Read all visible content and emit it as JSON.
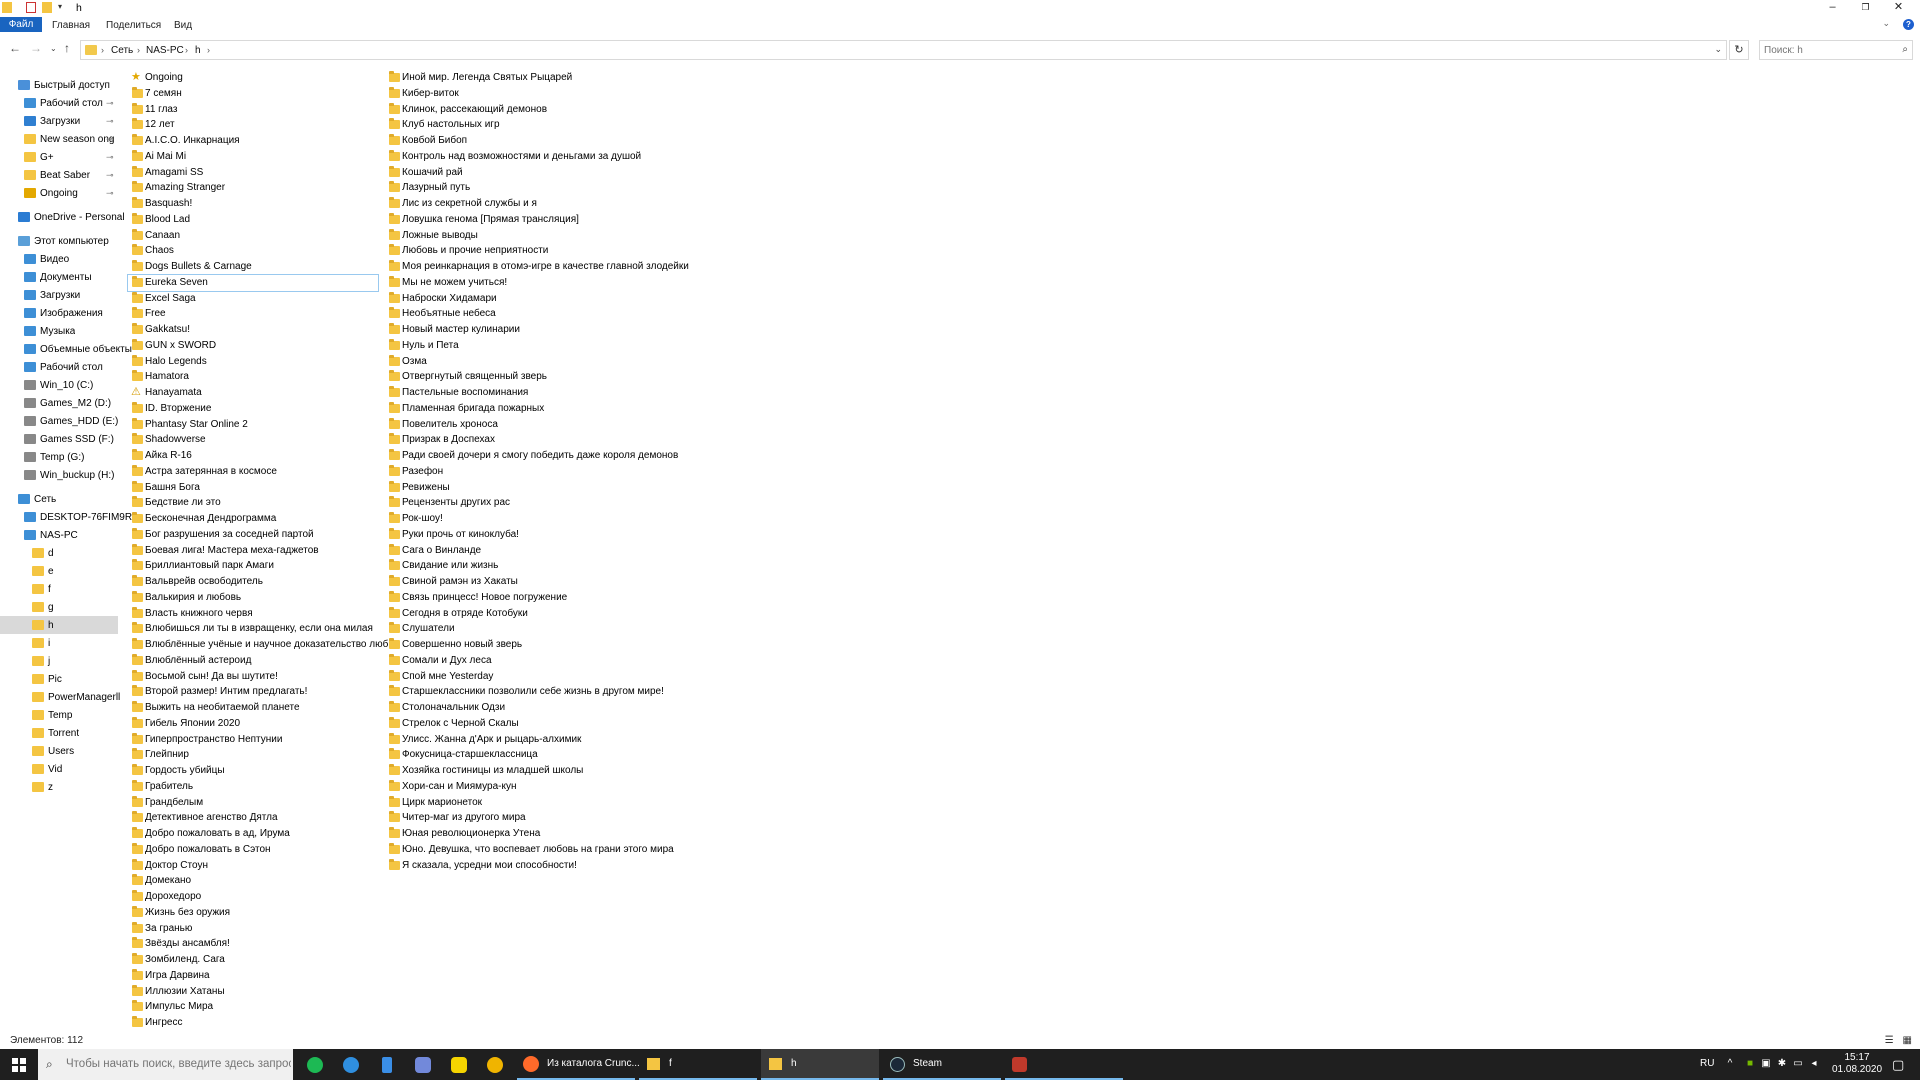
{
  "titlebar": {
    "title": "h",
    "minimize": "–",
    "maximize": "❐",
    "close": "✕"
  },
  "ribbon": {
    "tabs": [
      "Файл",
      "Главная",
      "Поделиться",
      "Вид"
    ]
  },
  "address": {
    "crumbs": [
      "Сеть",
      "NAS-PC",
      "h"
    ],
    "search_placeholder": "Поиск: h"
  },
  "navpane": {
    "quick_access": "Быстрый доступ",
    "quick_items": [
      "Рабочий стол",
      "Загрузки",
      "New season ong",
      "G+",
      "Beat Saber",
      "Ongoing"
    ],
    "onedrive": "OneDrive - Personal",
    "this_pc": "Этот компьютер",
    "pc_items": [
      "Видео",
      "Документы",
      "Загрузки",
      "Изображения",
      "Музыка",
      "Объемные объекты",
      "Рабочий стол",
      "Win_10 (C:)",
      "Games_M2 (D:)",
      "Games_HDD (E:)",
      "Games SSD (F:)",
      "Temp (G:)",
      "Win_buckup (H:)"
    ],
    "network": "Сеть",
    "network_items": [
      "DESKTOP-76FIM9R",
      "NAS-PC"
    ],
    "nas_items": [
      "d",
      "e",
      "f",
      "g",
      "h",
      "i",
      "j",
      "Pic",
      "PowerManagerll",
      "Temp",
      "Torrent",
      "Users",
      "Vid",
      "z"
    ]
  },
  "files": {
    "col1": [
      "Ongoing",
      "7 семян",
      "11 глаз",
      "12 лет",
      "A.I.C.O. Инкарнация",
      "Ai Mai Mi",
      "Amagami SS",
      "Amazing Stranger",
      "Basquash!",
      "Blood Lad",
      "Canaan",
      "Chaos",
      "Dogs Bullets & Carnage",
      "Eureka Seven",
      "Excel Saga",
      "Free",
      "Gakkatsu!",
      "GUN x SWORD",
      "Halo Legends",
      "Hamatora",
      "Hanayamata",
      "ID. Вторжение",
      "Phantasy Star Online 2",
      "Shadowverse",
      "Айка R-16",
      "Астра затерянная в космосе",
      "Башня Бога",
      "Бедствие ли это",
      "Бесконечная Дендрограмма",
      "Бог разрушения за соседней партой",
      "Боевая лига! Мастера меха-гаджетов",
      "Бриллиантовый парк Амаги",
      "Вальврейв освободитель",
      "Валькирия и любовь",
      "Власть книжного червя",
      "Влюбишься ли ты в извращенку, если она милая",
      "Влюблённые учёные и научное доказательство любви",
      "Влюблённый астероид",
      "Восьмой сын! Да вы шутите!",
      "Второй размер! Интим предлагать!",
      "Выжить на необитаемой планете",
      "Гибель Японии 2020",
      "Гиперпространство Нептунии",
      "Глейпнир",
      "Гордость убийцы",
      "Грабитель",
      "Грандбелым",
      "Детективное агенство Дятла",
      "Добро пожаловать в ад, Ирума",
      "Добро пожаловать в Сэтон",
      "Доктор Стоун",
      "Домекано",
      "Дорохедоро",
      "Жизнь без оружия",
      "За гранью",
      "Звёзды ансамбля!",
      "Зомбиленд. Сага",
      "Игра Дарвина",
      "Иллюзии Хатаны",
      "Импульс Мира",
      "Ингресс"
    ],
    "col2": [
      "Иной мир. Легенда Святых Рыцарей",
      "Кибер-виток",
      "Клинок, рассекающий демонов",
      "Клуб настольных игр",
      "Ковбой Бибоп",
      "Контроль над возможностями и деньгами за душой",
      "Кошачий рай",
      "Лазурный путь",
      "Лис из секретной службы и я",
      "Ловушка генома [Прямая трансляция]",
      "Ложные выводы",
      "Любовь и прочие неприятности",
      "Моя реинкарнация в отомэ-игре в качестве главной злодейки",
      "Мы не можем учиться!",
      "Наброски Хидамари",
      "Необъятные небеса",
      "Новый мастер кулинарии",
      "Нуль и Пета",
      "Озма",
      "Отвергнутый священный зверь",
      "Пастельные воспоминания",
      "Пламенная бригада пожарных",
      "Повелитель хроноса",
      "Призрак в Доспехах",
      "Ради своей дочери я смогу победить даже короля демонов",
      "Разефон",
      "Ревижены",
      "Рецензенты других рас",
      "Рок-шоу!",
      "Руки прочь от киноклуба!",
      "Сага о Винланде",
      "Свидание или жизнь",
      "Свиной рамэн из Хакаты",
      "Связь принцесс! Новое погружение",
      "Сегодня в отряде Котобуки",
      "Слушатели",
      "Совершенно новый зверь",
      "Сомали и Дух леса",
      "Спой мне Yesterday",
      "Старшеклассники позволили себе жизнь в другом мире!",
      "Столоначальник Одзи",
      "Стрелок с Черной Скалы",
      "Улисс. Жанна д'Арк и рыцарь-алхимик",
      "Фокусница-старшеклассница",
      "Хозяйка гостиницы из младшей школы",
      "Хори-сан и Миямура-кун",
      "Цирк марионеток",
      "Читер-маг из другого мира",
      "Юная революционерка Утена",
      "Юно. Девушка, что воспевает любовь на грани этого мира",
      "Я сказала, усредни мои способности!"
    ]
  },
  "status": {
    "count": "Элементов: 112"
  },
  "taskbar": {
    "search_placeholder": "Чтобы начать поиск, введите здесь запрос",
    "windows": [
      "Из каталога Crunc...",
      "f",
      "h",
      "Steam"
    ],
    "lang": "RU",
    "time": "15:17",
    "date": "01.08.2020"
  },
  "colors": {
    "accent": "#1964c0",
    "folder": "#f4c542",
    "taskbar": "#1f1f1f",
    "selection_border": "#99c9ef"
  }
}
